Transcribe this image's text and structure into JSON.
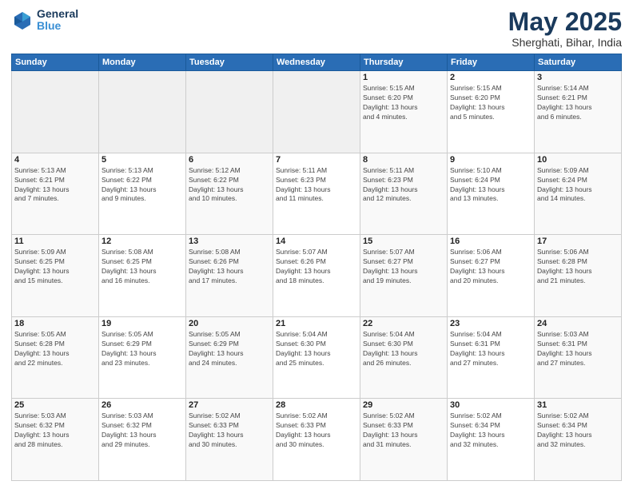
{
  "header": {
    "logo_line1": "General",
    "logo_line2": "Blue",
    "title": "May 2025",
    "subtitle": "Sherghati, Bihar, India"
  },
  "weekdays": [
    "Sunday",
    "Monday",
    "Tuesday",
    "Wednesday",
    "Thursday",
    "Friday",
    "Saturday"
  ],
  "weeks": [
    [
      {
        "day": "",
        "info": ""
      },
      {
        "day": "",
        "info": ""
      },
      {
        "day": "",
        "info": ""
      },
      {
        "day": "",
        "info": ""
      },
      {
        "day": "1",
        "info": "Sunrise: 5:15 AM\nSunset: 6:20 PM\nDaylight: 13 hours\nand 4 minutes."
      },
      {
        "day": "2",
        "info": "Sunrise: 5:15 AM\nSunset: 6:20 PM\nDaylight: 13 hours\nand 5 minutes."
      },
      {
        "day": "3",
        "info": "Sunrise: 5:14 AM\nSunset: 6:21 PM\nDaylight: 13 hours\nand 6 minutes."
      }
    ],
    [
      {
        "day": "4",
        "info": "Sunrise: 5:13 AM\nSunset: 6:21 PM\nDaylight: 13 hours\nand 7 minutes."
      },
      {
        "day": "5",
        "info": "Sunrise: 5:13 AM\nSunset: 6:22 PM\nDaylight: 13 hours\nand 9 minutes."
      },
      {
        "day": "6",
        "info": "Sunrise: 5:12 AM\nSunset: 6:22 PM\nDaylight: 13 hours\nand 10 minutes."
      },
      {
        "day": "7",
        "info": "Sunrise: 5:11 AM\nSunset: 6:23 PM\nDaylight: 13 hours\nand 11 minutes."
      },
      {
        "day": "8",
        "info": "Sunrise: 5:11 AM\nSunset: 6:23 PM\nDaylight: 13 hours\nand 12 minutes."
      },
      {
        "day": "9",
        "info": "Sunrise: 5:10 AM\nSunset: 6:24 PM\nDaylight: 13 hours\nand 13 minutes."
      },
      {
        "day": "10",
        "info": "Sunrise: 5:09 AM\nSunset: 6:24 PM\nDaylight: 13 hours\nand 14 minutes."
      }
    ],
    [
      {
        "day": "11",
        "info": "Sunrise: 5:09 AM\nSunset: 6:25 PM\nDaylight: 13 hours\nand 15 minutes."
      },
      {
        "day": "12",
        "info": "Sunrise: 5:08 AM\nSunset: 6:25 PM\nDaylight: 13 hours\nand 16 minutes."
      },
      {
        "day": "13",
        "info": "Sunrise: 5:08 AM\nSunset: 6:26 PM\nDaylight: 13 hours\nand 17 minutes."
      },
      {
        "day": "14",
        "info": "Sunrise: 5:07 AM\nSunset: 6:26 PM\nDaylight: 13 hours\nand 18 minutes."
      },
      {
        "day": "15",
        "info": "Sunrise: 5:07 AM\nSunset: 6:27 PM\nDaylight: 13 hours\nand 19 minutes."
      },
      {
        "day": "16",
        "info": "Sunrise: 5:06 AM\nSunset: 6:27 PM\nDaylight: 13 hours\nand 20 minutes."
      },
      {
        "day": "17",
        "info": "Sunrise: 5:06 AM\nSunset: 6:28 PM\nDaylight: 13 hours\nand 21 minutes."
      }
    ],
    [
      {
        "day": "18",
        "info": "Sunrise: 5:05 AM\nSunset: 6:28 PM\nDaylight: 13 hours\nand 22 minutes."
      },
      {
        "day": "19",
        "info": "Sunrise: 5:05 AM\nSunset: 6:29 PM\nDaylight: 13 hours\nand 23 minutes."
      },
      {
        "day": "20",
        "info": "Sunrise: 5:05 AM\nSunset: 6:29 PM\nDaylight: 13 hours\nand 24 minutes."
      },
      {
        "day": "21",
        "info": "Sunrise: 5:04 AM\nSunset: 6:30 PM\nDaylight: 13 hours\nand 25 minutes."
      },
      {
        "day": "22",
        "info": "Sunrise: 5:04 AM\nSunset: 6:30 PM\nDaylight: 13 hours\nand 26 minutes."
      },
      {
        "day": "23",
        "info": "Sunrise: 5:04 AM\nSunset: 6:31 PM\nDaylight: 13 hours\nand 27 minutes."
      },
      {
        "day": "24",
        "info": "Sunrise: 5:03 AM\nSunset: 6:31 PM\nDaylight: 13 hours\nand 27 minutes."
      }
    ],
    [
      {
        "day": "25",
        "info": "Sunrise: 5:03 AM\nSunset: 6:32 PM\nDaylight: 13 hours\nand 28 minutes."
      },
      {
        "day": "26",
        "info": "Sunrise: 5:03 AM\nSunset: 6:32 PM\nDaylight: 13 hours\nand 29 minutes."
      },
      {
        "day": "27",
        "info": "Sunrise: 5:02 AM\nSunset: 6:33 PM\nDaylight: 13 hours\nand 30 minutes."
      },
      {
        "day": "28",
        "info": "Sunrise: 5:02 AM\nSunset: 6:33 PM\nDaylight: 13 hours\nand 30 minutes."
      },
      {
        "day": "29",
        "info": "Sunrise: 5:02 AM\nSunset: 6:33 PM\nDaylight: 13 hours\nand 31 minutes."
      },
      {
        "day": "30",
        "info": "Sunrise: 5:02 AM\nSunset: 6:34 PM\nDaylight: 13 hours\nand 32 minutes."
      },
      {
        "day": "31",
        "info": "Sunrise: 5:02 AM\nSunset: 6:34 PM\nDaylight: 13 hours\nand 32 minutes."
      }
    ]
  ]
}
